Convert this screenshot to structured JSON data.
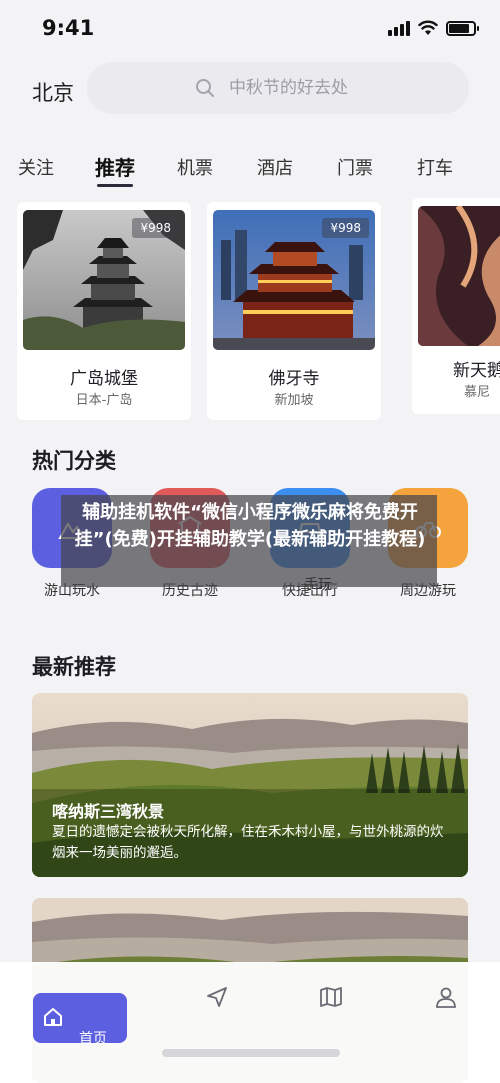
{
  "status_bar": {
    "time": "9:41"
  },
  "header": {
    "city": "北京",
    "search_placeholder": "中秋节的好去处"
  },
  "tabs": [
    {
      "label": "关注",
      "active": false
    },
    {
      "label": "推荐",
      "active": true
    },
    {
      "label": "机票",
      "active": false
    },
    {
      "label": "酒店",
      "active": false
    },
    {
      "label": "门票",
      "active": false
    },
    {
      "label": "打车",
      "active": false
    }
  ],
  "destinations": [
    {
      "price": "¥998",
      "name": "广岛城堡",
      "place": "日本-广岛"
    },
    {
      "price": "¥998",
      "name": "佛牙寺",
      "place": "新加坡"
    },
    {
      "name": "新天鹅",
      "place": "慕尼"
    }
  ],
  "hot_categories": {
    "title": "热门分类",
    "items": [
      {
        "label": "游山玩水",
        "color": "#5b5fe0",
        "icon": "mountain-icon"
      },
      {
        "label": "历史古迹",
        "color": "#e05a5a",
        "icon": "temple-icon"
      },
      {
        "label": "快捷出行",
        "color": "#3c8ef0",
        "icon": "car-icon"
      },
      {
        "label": "周边游玩",
        "color": "#f5a33c",
        "icon": "bike-icon"
      }
    ]
  },
  "overlay_banner": "辅助挂机软件“微信小程序微乐麻将免费开挂”(免费)开挂辅助教学(最新辅助开挂教程)",
  "overlay_partial": "手玩",
  "latest": {
    "title": "最新推荐",
    "items": [
      {
        "title": "喀纳斯三湾秋景",
        "desc": "夏日的遗憾定会被秋天所化解，住在禾木村小屋，与世外桃源的炊烟来一场美丽的邂逅。"
      }
    ]
  },
  "bottom_nav": [
    {
      "label": "首页",
      "icon": "home-icon",
      "active": true
    },
    {
      "icon": "send-icon"
    },
    {
      "icon": "map-icon"
    },
    {
      "icon": "user-icon"
    }
  ],
  "colors": {
    "accent": "#5b5fe0",
    "background": "#f3f3f6"
  }
}
